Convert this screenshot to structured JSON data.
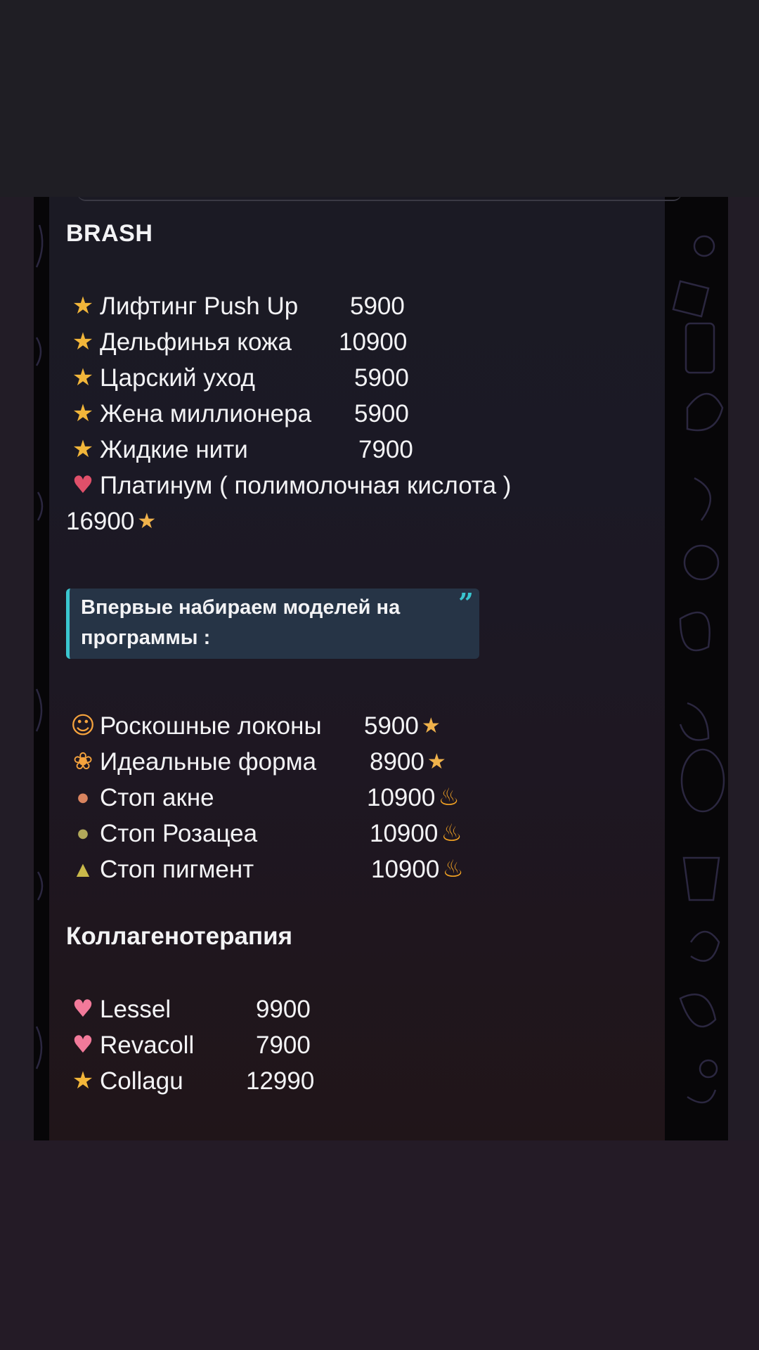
{
  "title": "BRASH",
  "programs": [
    {
      "icon": "star",
      "name": "Лифтинг Push Up",
      "price": "5900"
    },
    {
      "icon": "star",
      "name": "Дельфинья кожа",
      "price": "10900"
    },
    {
      "icon": "star",
      "name": "Царский уход",
      "price": "5900"
    },
    {
      "icon": "star",
      "name": "Жена миллионера",
      "price": "5900"
    },
    {
      "icon": "star",
      "name": "Жидкие нити",
      "price": "7900"
    }
  ],
  "platinum": {
    "name": "Платинум ( полимолочная кислота )",
    "price": "16900"
  },
  "quote": "Впервые набираем моделей на программы :",
  "model_programs": [
    {
      "name": "Роскошные локоны",
      "price": "5900"
    },
    {
      "name": "Идеальные форма",
      "price": "8900"
    },
    {
      "name": "Стоп акне",
      "price": "10900"
    },
    {
      "name": "Стоп Розацеа",
      "price": "10900"
    },
    {
      "name": "Стоп пигмент",
      "price": "10900"
    }
  ],
  "collagen_title": "Коллагенотерапия",
  "collagen": [
    {
      "name": "Lessel",
      "price": "9900"
    },
    {
      "name": "Revacoll",
      "price": "7900"
    },
    {
      "name": "Collagu",
      "price": "12990"
    }
  ],
  "colors": {
    "background": "#221c26",
    "message": "#1b1a24",
    "quote_bg": "#263446",
    "quote_accent": "#3ac6cf",
    "text": "#f3f3f5"
  }
}
